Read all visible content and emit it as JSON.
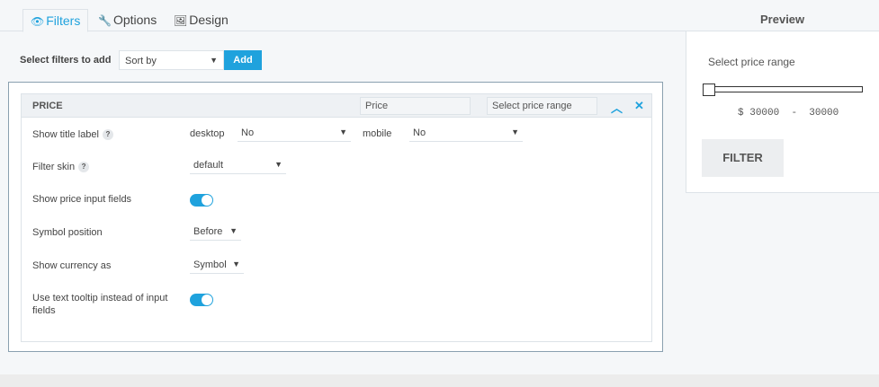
{
  "tabs": [
    {
      "label": "Filters",
      "icon": "eye-icon",
      "active": true
    },
    {
      "label": "Options",
      "icon": "wrench-icon",
      "active": false
    },
    {
      "label": "Design",
      "icon": "image-icon",
      "active": false
    }
  ],
  "colors": {
    "accent": "#1fa2dd",
    "border": "#dde3e8"
  },
  "toolbar": {
    "select_label": "Select filters to add",
    "sort_value": "Sort by",
    "add_label": "Add"
  },
  "filter": {
    "title": "PRICE",
    "name_value": "Price",
    "placeholder_value": "Select price range",
    "rows": {
      "show_title": {
        "label": "Show title label",
        "desktop_label": "desktop",
        "desktop_value": "No",
        "mobile_label": "mobile",
        "mobile_value": "No"
      },
      "skin": {
        "label": "Filter skin",
        "value": "default"
      },
      "price_inputs": {
        "label": "Show price input fields",
        "on": true
      },
      "symbol_position": {
        "label": "Symbol position",
        "value": "Before"
      },
      "currency": {
        "label": "Show currency as",
        "value": "Symbol"
      },
      "tooltip": {
        "label": "Use text tooltip instead of input fields",
        "on": true
      }
    }
  },
  "preview": {
    "title": "Preview",
    "label": "Select price range",
    "currency_symbol": "$",
    "min": "30000",
    "separator": "-",
    "max": "30000",
    "button_label": "FILTER"
  }
}
